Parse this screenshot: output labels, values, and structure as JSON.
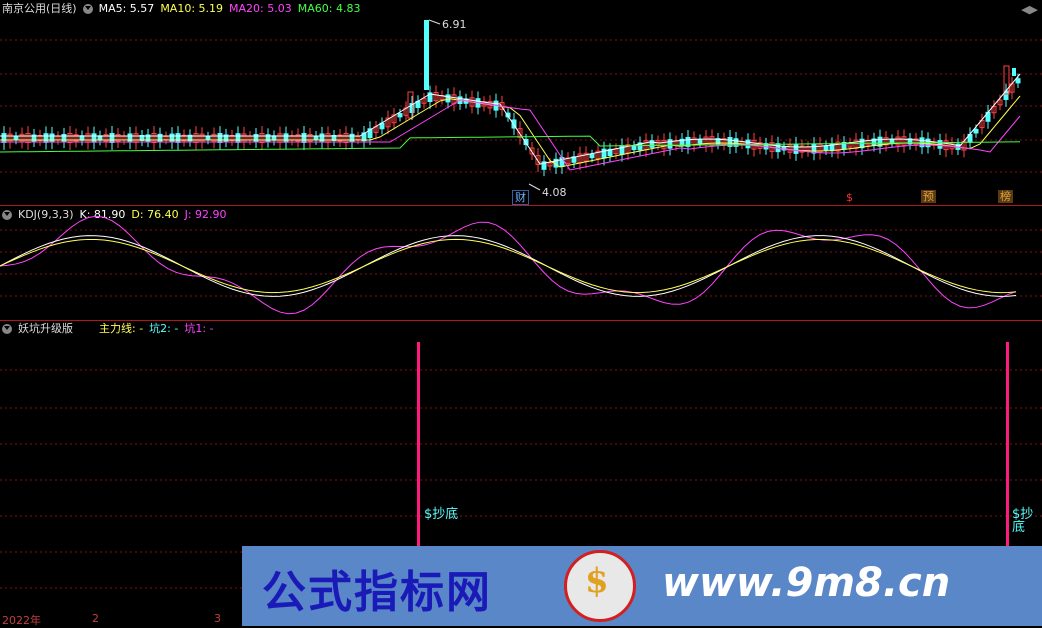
{
  "main_panel": {
    "title": "南京公用(日线)",
    "ma": [
      {
        "label": "MA5: 5.57",
        "color": "#ffffff"
      },
      {
        "label": "MA10: 5.19",
        "color": "#ffff55"
      },
      {
        "label": "MA20: 5.03",
        "color": "#ff44ff"
      },
      {
        "label": "MA60: 4.83",
        "color": "#44ff44"
      }
    ],
    "high_label": "6.91",
    "low_label": "4.08",
    "markers": [
      {
        "text": "财",
        "color": "#6ab0ff"
      },
      {
        "text": "$",
        "color": "#ff3030"
      },
      {
        "text": "预",
        "color": "#e0a040"
      },
      {
        "text": "榜",
        "color": "#e0a040"
      }
    ]
  },
  "kdj_panel": {
    "title": "KDJ(9,3,3)",
    "k": "K: 81.90",
    "d": "D: 76.40",
    "j": "J: 92.90",
    "colors": {
      "k": "#ffffff",
      "d": "#ffff55",
      "j": "#ff44ff"
    }
  },
  "yk_panel": {
    "title": "妖坑升级版",
    "main_line": "主力线: -",
    "keng2": "坑2: -",
    "keng1": "坑1: -",
    "signal_text": "$抄底",
    "signal_text_2": "$抄底",
    "colors": {
      "main": "#ffff55",
      "keng2": "#55ffff",
      "keng1": "#ff44ff",
      "signal": "#ff1a80"
    }
  },
  "time_axis": {
    "labels": [
      "2022年",
      "2",
      "3"
    ]
  },
  "watermark": {
    "text_cn": "公式指标网",
    "url": "www.9m8.cn",
    "logo_glyph": "$"
  }
}
